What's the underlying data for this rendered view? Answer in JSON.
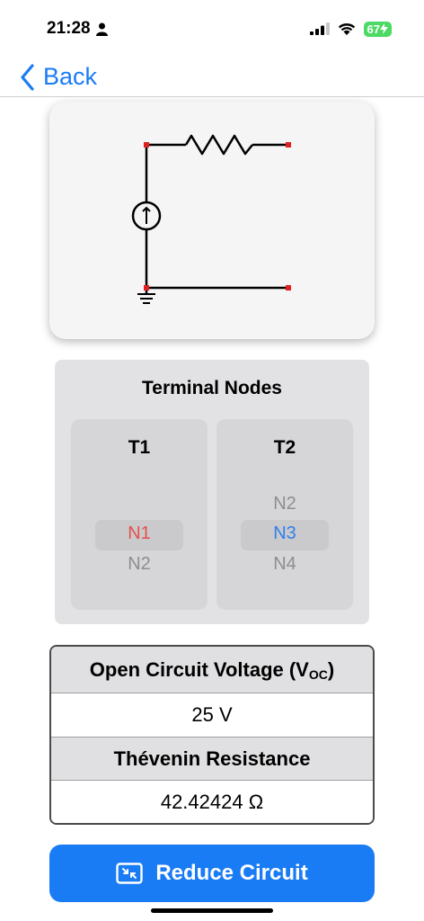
{
  "status_bar": {
    "time": "21:28",
    "battery": "67"
  },
  "nav": {
    "back_label": "Back"
  },
  "terminal_nodes": {
    "title": "Terminal Nodes",
    "t1": {
      "header": "T1",
      "selected": "N1",
      "below": "N2"
    },
    "t2": {
      "header": "T2",
      "above": "N2",
      "selected": "N3",
      "below": "N4"
    }
  },
  "results": {
    "voc_label": "Open Circuit Voltage (V",
    "voc_sub": "OC",
    "voc_close": ")",
    "voc_value": "25 V",
    "rth_label": "Thévenin Resistance",
    "rth_value": "42.42424 Ω"
  },
  "actions": {
    "reduce_label": "Reduce Circuit"
  },
  "colors": {
    "accent": "#1a7cf5",
    "terminal_red": "#e5504a",
    "terminal_blue": "#2f80ed",
    "battery_green": "#4cd964"
  }
}
